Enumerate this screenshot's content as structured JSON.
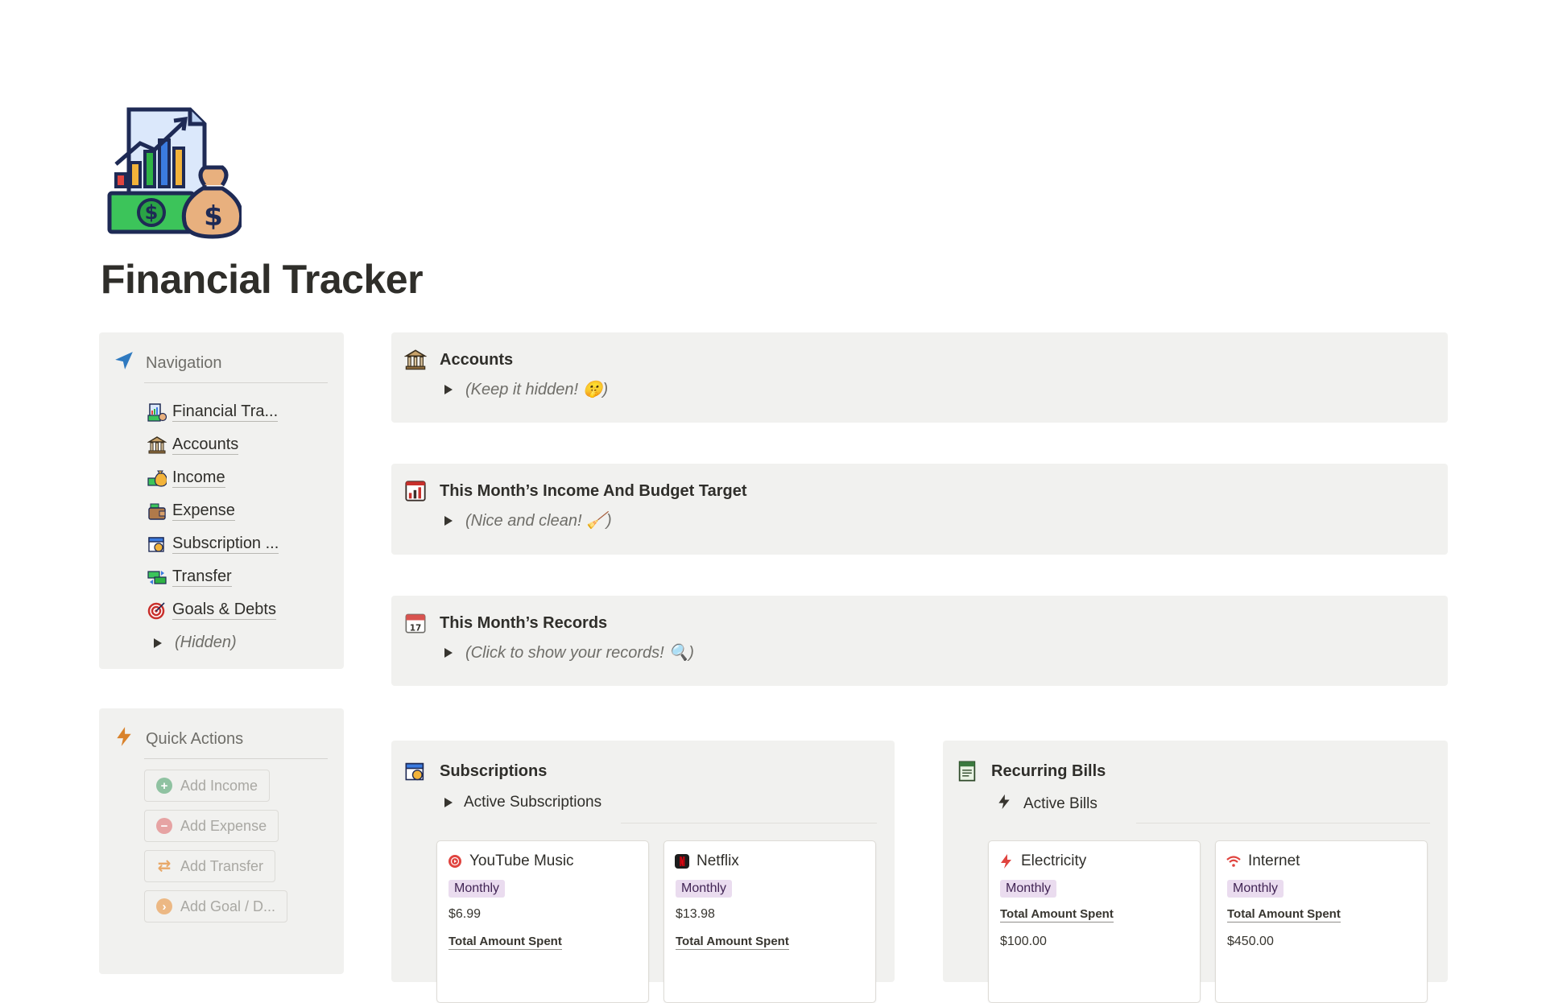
{
  "page": {
    "title": "Financial Tracker",
    "icon": "financial-tracker-icon"
  },
  "navigation": {
    "header": "Navigation",
    "icon": "navigation-arrow-icon",
    "items": [
      {
        "label": "Financial Tra...",
        "icon": "chart-money-icon"
      },
      {
        "label": "Accounts",
        "icon": "bank-icon"
      },
      {
        "label": "Income",
        "icon": "money-bag-icon"
      },
      {
        "label": "Expense",
        "icon": "wallet-icon"
      },
      {
        "label": "Subscription ...",
        "icon": "calendar-coin-icon"
      },
      {
        "label": "Transfer",
        "icon": "money-transfer-icon"
      },
      {
        "label": "Goals & Debts",
        "icon": "target-icon"
      }
    ],
    "hidden_toggle": "(Hidden)"
  },
  "quick_actions": {
    "header": "Quick Actions",
    "icon": "lightning-icon",
    "buttons": [
      {
        "label": "Add Income",
        "color": "#6fb08a",
        "glyph": "+"
      },
      {
        "label": "Add Expense",
        "color": "#e28a8a",
        "glyph": "−"
      },
      {
        "label": "Add Transfer",
        "color": "#e8a868",
        "glyph": "⇄"
      },
      {
        "label": "Add Goal / D...",
        "color": "#e8a868",
        "glyph": "›"
      }
    ]
  },
  "callouts": {
    "accounts": {
      "title": "Accounts",
      "toggle": "(Keep it hidden! 🤫)",
      "icon": "bank-icon"
    },
    "income_budget": {
      "title": "This Month’s Income And Budget Target",
      "toggle": "(Nice and clean! 🧹)",
      "icon": "chart-icon"
    },
    "records": {
      "title": "This Month’s Records",
      "toggle": "(Click to show your records! 🔍)",
      "icon": "calendar-icon"
    }
  },
  "subscriptions": {
    "title": "Subscriptions",
    "view": "Active Subscriptions",
    "cards": [
      {
        "name": "YouTube Music",
        "icon": "youtube-music-icon",
        "frequency": "Monthly",
        "price": "$6.99",
        "total_label": "Total Amount Spent"
      },
      {
        "name": "Netflix",
        "icon": "netflix-icon",
        "frequency": "Monthly",
        "price": "$13.98",
        "total_label": "Total Amount Spent"
      }
    ]
  },
  "bills": {
    "title": "Recurring Bills",
    "view": "Active Bills",
    "cards": [
      {
        "name": "Electricity",
        "icon": "lightning-icon",
        "frequency": "Monthly",
        "total_label": "Total Amount Spent",
        "amount": "$100.00"
      },
      {
        "name": "Internet",
        "icon": "wifi-icon",
        "frequency": "Monthly",
        "total_label": "Total Amount Spent",
        "amount": "$450.00"
      }
    ]
  }
}
